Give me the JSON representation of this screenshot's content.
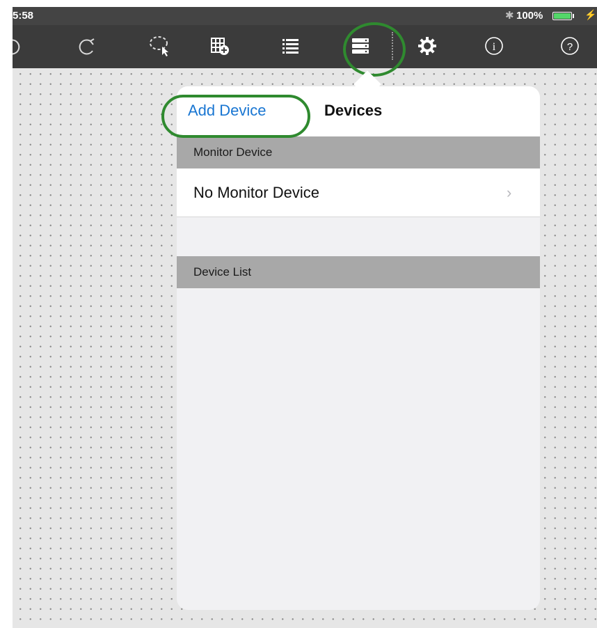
{
  "status_bar": {
    "time": "5:58",
    "bluetooth_icon": "bluetooth-icon",
    "battery_percent": "100%",
    "battery_level": 1.0,
    "charging_icon": "charging-bolt-icon"
  },
  "toolbar": {
    "buttons": [
      {
        "name": "undo",
        "icon": "undo-icon"
      },
      {
        "name": "redo",
        "icon": "redo-icon"
      },
      {
        "name": "lasso-select",
        "icon": "lasso-select-icon"
      },
      {
        "name": "add-object",
        "icon": "grid-add-icon"
      },
      {
        "name": "list",
        "icon": "list-icon"
      },
      {
        "name": "devices",
        "icon": "devices-stack-icon",
        "active": true
      },
      {
        "name": "settings",
        "icon": "gear-icon"
      },
      {
        "name": "info",
        "icon": "info-icon"
      },
      {
        "name": "help",
        "icon": "help-icon"
      }
    ]
  },
  "popover": {
    "add_device_label": "Add Device",
    "title": "Devices",
    "monitor_section_label": "Monitor Device",
    "monitor_row_label": "No Monitor Device",
    "device_list_section_label": "Device List",
    "device_list": []
  },
  "colors": {
    "toolbar_bg": "#3b3b3b",
    "accent_blue": "#1976d2",
    "highlight_green": "#2f8a2f",
    "section_header_bg": "#a8a8a8",
    "canvas_bg": "#e6e6e6",
    "battery_green": "#53d769"
  }
}
